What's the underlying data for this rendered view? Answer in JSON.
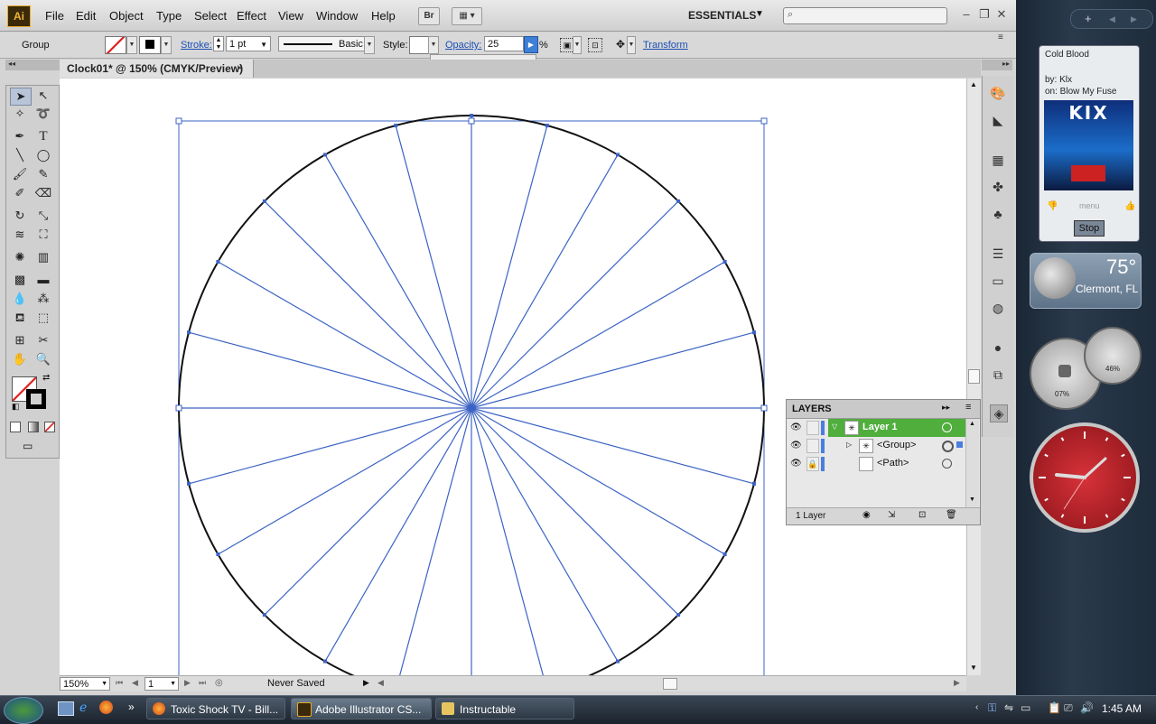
{
  "app": {
    "logo": "Ai",
    "menu": [
      "File",
      "Edit",
      "Object",
      "Type",
      "Select",
      "Effect",
      "View",
      "Window",
      "Help"
    ],
    "bridge_label": "Br",
    "workspace": "ESSENTIALS",
    "search_placeholder": ""
  },
  "control_bar": {
    "selection": "Group",
    "stroke_label": "Stroke:",
    "stroke_weight": "1 pt",
    "brush": "Basic",
    "style_label": "Style:",
    "opacity_label": "Opacity:",
    "opacity_value": "25",
    "percent": "%",
    "transform": "Transform"
  },
  "document": {
    "tab_title": "Clock01* @ 150% (CMYK/Preview)",
    "close": "×"
  },
  "status_bar": {
    "zoom": "150%",
    "artboard": "1",
    "status": "Never Saved"
  },
  "layers": {
    "title": "LAYERS",
    "rows": [
      {
        "name": "Layer 1"
      },
      {
        "name": "<Group>"
      },
      {
        "name": "<Path>"
      }
    ],
    "footer": "1 Layer"
  },
  "canvas": {
    "spoke_count": 24,
    "spoke_color": "#3b63c4",
    "circle_color": "#111111"
  },
  "sidebar": {
    "player": {
      "title": "Cold Blood",
      "artist": "by: Klx",
      "album": "on: Blow My Fuse",
      "cover_text": "KIX",
      "menu": "menu",
      "stop": "Stop"
    },
    "weather": {
      "temp": "75°",
      "city": "Clermont, FL"
    },
    "meters": {
      "cpu": "07%",
      "mem": "46%"
    }
  },
  "taskbar": {
    "tasks": [
      {
        "label": "Toxic Shock TV - Bill...",
        "active": false
      },
      {
        "label": "Adobe Illustrator CS...",
        "active": true
      },
      {
        "label": "Instructable",
        "active": false
      }
    ],
    "time": "1:45 AM"
  }
}
